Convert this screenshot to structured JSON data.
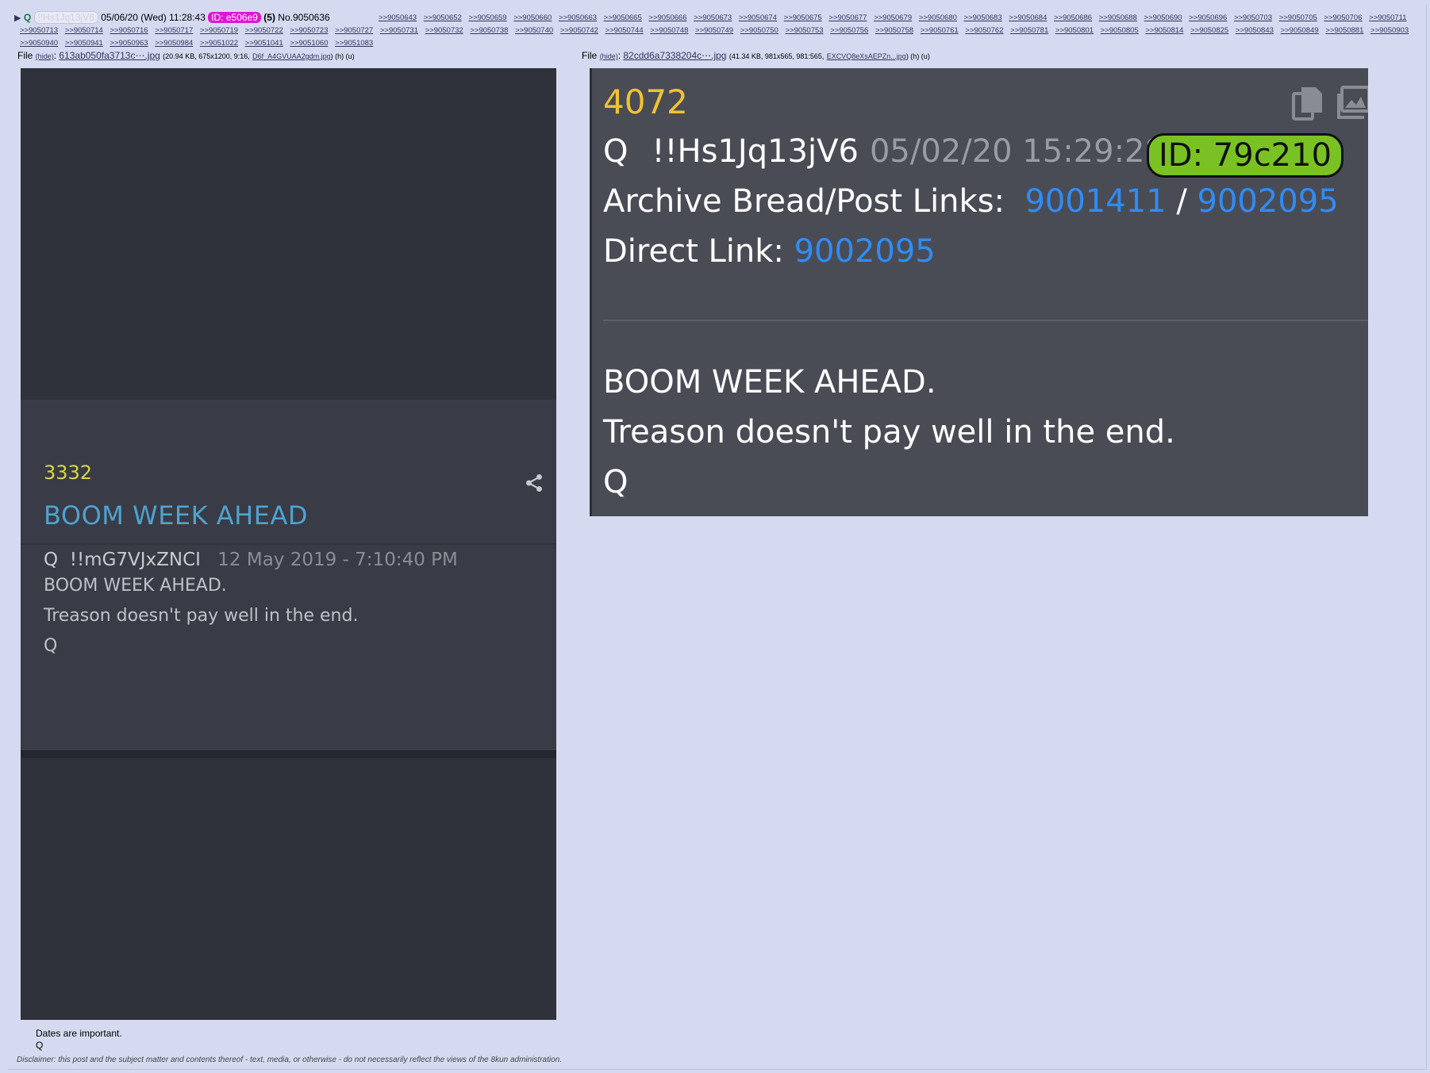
{
  "header": {
    "arrow": "▶",
    "name": "Q",
    "tripcode": "!!Hs1Jq13jV6",
    "datetime": "05/06/20 (Wed) 11:28:43",
    "id": "ID: e506e9",
    "count": "(5)",
    "post_no": "No.9050636"
  },
  "backlinks": [
    ">>9050643",
    ">>9050652",
    ">>9050659",
    ">>9050660",
    ">>9050663",
    ">>9050665",
    ">>9050666",
    ">>9050673",
    ">>9050674",
    ">>9050675",
    ">>9050677",
    ">>9050679",
    ">>9050680",
    ">>9050683",
    ">>9050684",
    ">>9050686",
    ">>9050688",
    ">>9050690",
    ">>9050696",
    ">>9050703",
    ">>9050705",
    ">>9050706",
    ">>9050711",
    ">>9050713",
    ">>9050714",
    ">>9050716",
    ">>9050717",
    ">>9050719",
    ">>9050722",
    ">>9050723",
    ">>9050727",
    ">>9050731",
    ">>9050732",
    ">>9050738",
    ">>9050740",
    ">>9050742",
    ">>9050744",
    ">>9050748",
    ">>9050749",
    ">>9050750",
    ">>9050753",
    ">>9050756",
    ">>9050758",
    ">>9050761",
    ">>9050762",
    ">>9050781",
    ">>9050801",
    ">>9050805",
    ">>9050814",
    ">>9050825",
    ">>9050843",
    ">>9050849",
    ">>9050881",
    ">>9050903",
    ">>9050940",
    ">>9050941",
    ">>9050963",
    ">>9050984",
    ">>9051022",
    ">>9051041",
    ">>9051060",
    ">>9051083"
  ],
  "files": [
    {
      "label": "File",
      "hide": "(hide)",
      "name": "613ab050fa3713c⋯.jpg",
      "meta": "(20.94 KB, 675x1200, 9:16,",
      "orig": "D6f_A4GVUAA2gdm.jpg",
      "tail": ") (h) (u)"
    },
    {
      "label": "File",
      "hide": "(hide)",
      "name": "82cdd6a7338204c⋯.jpg",
      "meta": "(41.34 KB, 981x565, 981:565,",
      "orig": "EXCVQ8eXsAEPZn...jpg",
      "tail": ") (h) (u)"
    }
  ],
  "left_image": {
    "number": "3332",
    "title": "BOOM WEEK AHEAD",
    "author": "Q",
    "trip": "!!mG7VJxZNCI",
    "date": "12 May 2019 - 7:10:40 PM",
    "body": [
      "BOOM WEEK AHEAD.",
      "Treason doesn't pay well in the end.",
      "Q"
    ],
    "icon": "share-icon"
  },
  "right_image": {
    "number": "4072",
    "author": "Q",
    "trip": "!!Hs1Jq13jV6",
    "date": "05/02/20 15:29:28",
    "id": "ID: 79c210",
    "archive_label": "Archive Bread/Post Links:",
    "archive_link1": "9001411",
    "archive_sep": "/",
    "archive_link2": "9002095",
    "direct_label": "Direct Link:",
    "direct_link": "9002095",
    "body": [
      "BOOM WEEK AHEAD.",
      "Treason doesn't pay well in the end.",
      "Q"
    ],
    "icons": [
      "copy-icon",
      "image-icon"
    ]
  },
  "message": [
    "Dates are important.",
    "Q"
  ],
  "disclaimer": "Disclaimer: this post and the subject matter and contents thereof - text, media, or otherwise - do not necessarily reflect the views of the 8kun administration.",
  "colors": {
    "background": "#d6daf0",
    "id_badge": "#e014d6",
    "id_box_green": "#7ac224",
    "link_blue": "#2f8cf6",
    "number_yellow": "#f1c232"
  }
}
